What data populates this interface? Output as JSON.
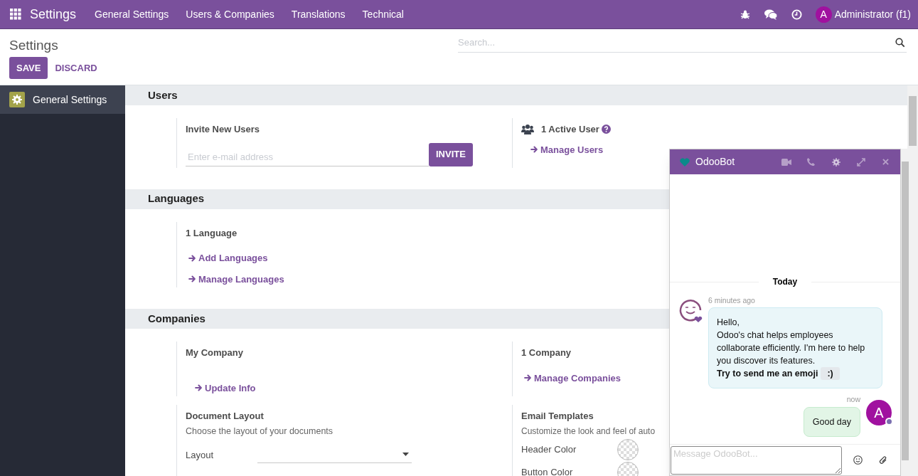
{
  "navbar": {
    "app_title": "Settings",
    "menu": [
      "General Settings",
      "Users & Companies",
      "Translations",
      "Technical"
    ],
    "avatar_letter": "A",
    "user_name": "Administrator (f1)"
  },
  "control_panel": {
    "title": "Settings",
    "search": {
      "placeholder": "Search..."
    },
    "buttons": [
      {
        "label": "SAVE",
        "kind": "primary"
      },
      {
        "label": "DISCARD",
        "kind": "link"
      }
    ]
  },
  "sidebar": {
    "items": [
      {
        "label": "General Settings",
        "selected": true
      }
    ]
  },
  "sections": [
    {
      "title": "Users",
      "rows": [
        [
          {
            "kind": "invite",
            "title": "Invite New Users",
            "input": {
              "placeholder": "Enter e-mail address",
              "button": "INVITE"
            }
          },
          {
            "kind": "user_count",
            "title": "1 Active User",
            "links": [
              "Manage Users"
            ]
          }
        ]
      ]
    },
    {
      "title": "Languages",
      "rows": [
        [
          {
            "kind": "links",
            "title": "1 Language",
            "links": [
              "Add Languages",
              "Manage Languages"
            ]
          }
        ]
      ]
    },
    {
      "title": "Companies",
      "rows": [
        [
          {
            "kind": "company",
            "title": "My Company",
            "links": [
              "Update Info"
            ]
          },
          {
            "kind": "links",
            "title": "1 Company",
            "links": [
              "Manage Companies"
            ]
          }
        ],
        [
          {
            "kind": "layout",
            "title": "Document Layout",
            "description": "Choose the layout of your documents",
            "selects": [
              {
                "label": "Layout"
              }
            ]
          },
          {
            "kind": "email",
            "title": "Email Templates",
            "description": "Customize the look and feel of auto",
            "colors": [
              {
                "label": "Header Color"
              },
              {
                "label": "Button Color"
              }
            ]
          }
        ]
      ]
    }
  ],
  "chat": {
    "title": "OdooBot",
    "date_separator": "Today",
    "messages": [
      {
        "kind": "received",
        "time": "6 minutes ago",
        "paragraphs": [
          "Hello,",
          "Odoo's chat helps employees collaborate efficiently. I'm here to help you discover its features."
        ],
        "emphasis": "Try to send me an emoji",
        "chip": ":)"
      },
      {
        "kind": "sent",
        "time": "now",
        "avatar_letter": "A",
        "paragraphs": [
          "Good day"
        ]
      }
    ],
    "composer": {
      "placeholder": "Message OdooBot..."
    }
  }
}
